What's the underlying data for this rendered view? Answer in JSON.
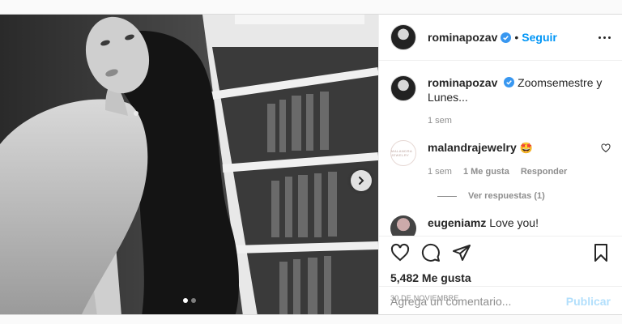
{
  "post": {
    "author": "rominapozav",
    "follow_label": "Seguir",
    "separator": "•",
    "verified_color": "#3897f0",
    "accent": "#0095f6",
    "publish_color": "#b2dffc",
    "image_alt": "black and white portrait photo",
    "carousel": {
      "count": 2,
      "active": 0
    }
  },
  "caption": {
    "username": "rominapozav",
    "text": "Zoomsemestre y Lunes...",
    "time": "1 sem"
  },
  "comments": [
    {
      "username": "malandrajewelry",
      "text": "🤩",
      "time": "1 sem",
      "likes": "1 Me gusta",
      "reply_label": "Responder",
      "avatar_text": "MALANDRA JEWELRY"
    }
  ],
  "view_replies": "Ver respuestas (1)",
  "partial_comment": {
    "username": "eugeniamz",
    "text": "Love you!"
  },
  "stats": {
    "likes": "5,482 Me gusta",
    "date": "30 DE NOVIEMBRE"
  },
  "composer": {
    "placeholder": "Agrega un comentario...",
    "publish_label": "Publicar"
  },
  "icons": [
    "heart-icon",
    "comment-icon",
    "share-icon",
    "bookmark-icon",
    "more-icon",
    "verified-icon",
    "chevron-right-icon"
  ]
}
